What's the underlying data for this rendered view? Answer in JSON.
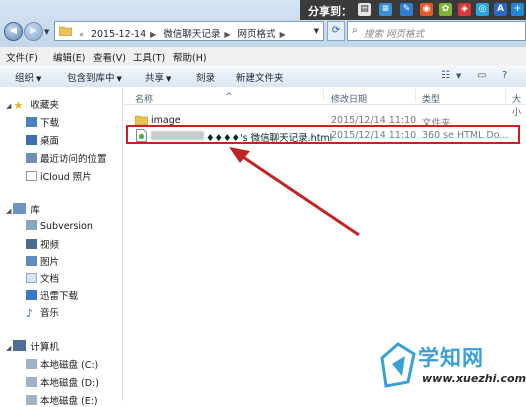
{
  "share_bar": {
    "label": "分享到：",
    "icons": [
      "qq-share-icon",
      "tencent-weibo-icon",
      "kaixin-icon",
      "renren-icon",
      "sina-weibo-icon",
      "douban-icon",
      "qzone-icon",
      "baidu-icon",
      "more-icon"
    ]
  },
  "address": {
    "prefix": "«",
    "crumbs": [
      "2015-12-14",
      "微信聊天记录",
      "网页格式"
    ],
    "search_placeholder": "搜索 网页格式"
  },
  "menu": [
    "文件(F)",
    "编辑(E)",
    "查看(V)",
    "工具(T)",
    "帮助(H)"
  ],
  "toolbar": {
    "organize": "组织",
    "include_library": "包含到库中",
    "share": "共享",
    "burn": "刻录",
    "new_folder": "新建文件夹"
  },
  "nav": {
    "favorites": {
      "title": "收藏夹",
      "items": [
        "下载",
        "桌面",
        "最近访问的位置",
        "iCloud 照片"
      ]
    },
    "libraries": {
      "title": "库",
      "items": [
        "Subversion",
        "视频",
        "图片",
        "文档",
        "迅雷下载",
        "音乐"
      ]
    },
    "computer": {
      "title": "计算机",
      "items": [
        "本地磁盘 (C:)",
        "本地磁盘 (D:)",
        "本地磁盘 (E:)"
      ]
    }
  },
  "columns": [
    "名称",
    "修改日期",
    "类型",
    "大小"
  ],
  "files": [
    {
      "name": "image",
      "date": "2015/12/14 11:10",
      "type": "文件夹"
    },
    {
      "name": "♦♦♦♦'s 微信聊天记录.html",
      "date": "2015/12/14 11:10",
      "type": "360 se HTML Do..."
    }
  ],
  "watermark": {
    "name": "学知网",
    "url": "www.xuezhi.com"
  },
  "colors": {
    "highlight_border": "#cc1f1f",
    "arrow": "#c42323",
    "watermark_blue": "#3aa0d8"
  }
}
